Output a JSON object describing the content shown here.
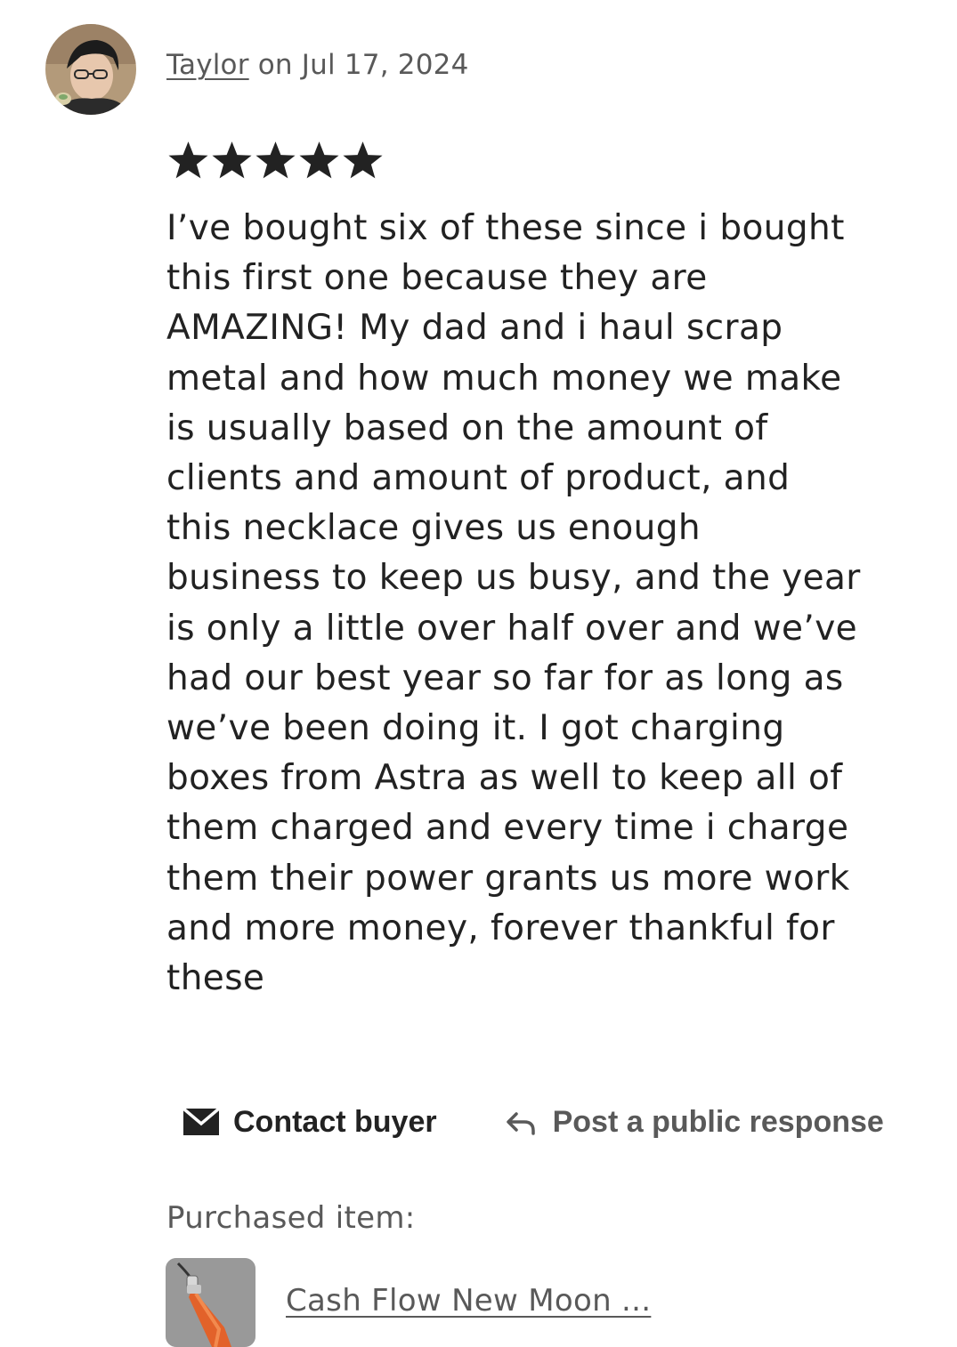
{
  "review": {
    "author": "Taylor",
    "date_text": " on Jul 17, 2024",
    "rating_stars": 5,
    "body_lines": [
      "I’ve bought six of these since i bought",
      "this first one because they are",
      "AMAZING! My dad and i haul scrap",
      "metal and how much money we make",
      "is usually based on the amount of",
      "clients and amount of product, and",
      "this necklace gives us enough",
      "business to keep us busy, and the year",
      "is only a little over half over and we’ve",
      "had our best year so far for as long as",
      "we’ve been doing it. I got charging",
      "boxes from Astra as well to keep all of",
      "them charged and every time i charge",
      "them their power grants us more work",
      "and more money, forever thankful for",
      "these"
    ]
  },
  "actions": {
    "contact_label": "Contact buyer",
    "contact_icon": "mail-icon",
    "post_label": "Post a public response",
    "post_icon": "reply-arrow-icon"
  },
  "purchased": {
    "label": "Purchased item:",
    "item_title": "Cash Flow New Moon ...",
    "thumbnail": "orange-crystal-pendant-photo"
  },
  "colors": {
    "text_primary": "#222222",
    "text_secondary": "#595959",
    "background": "#ffffff"
  }
}
